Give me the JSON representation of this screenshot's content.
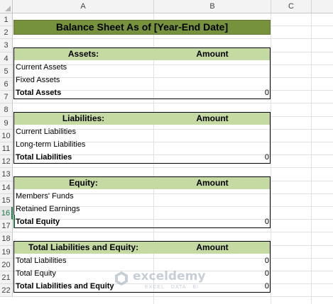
{
  "columns": [
    "A",
    "B",
    "C"
  ],
  "rows": [
    "1",
    "2",
    "3",
    "4",
    "5",
    "6",
    "7",
    "8",
    "9",
    "10",
    "11",
    "12",
    "13",
    "14",
    "15",
    "16",
    "17",
    "18",
    "19",
    "20",
    "21",
    "22"
  ],
  "selected_row": "16",
  "title": "Balance Sheet As of [Year-End Date]",
  "assets": {
    "header": "Assets:",
    "amount_header": "Amount",
    "current": "Current Assets",
    "fixed": "Fixed Assets",
    "total_label": "Total Assets",
    "total_value": "0"
  },
  "liabilities": {
    "header": "Liabilities:",
    "amount_header": "Amount",
    "current": "Current Liabilities",
    "longterm": "Long-term Liabilities",
    "total_label": "Total Liabilities",
    "total_value": "0"
  },
  "equity": {
    "header": "Equity:",
    "amount_header": "Amount",
    "members": "Members' Funds",
    "retained": "Retained Earnings",
    "total_label": "Total Equity",
    "total_value": "0"
  },
  "summary": {
    "header": "Total Liabilities and Equity:",
    "amount_header": "Amount",
    "liab_label": "Total Liabilities",
    "liab_value": "0",
    "equity_label": "Total Equity",
    "equity_value": "0",
    "total_label": "Total Liabilities and Equity",
    "total_value": "0"
  },
  "watermark": {
    "name": "exceldemy",
    "tagline": "EXCEL · DATA · BI"
  },
  "colors": {
    "title_fill": "#76923c",
    "header_fill": "#c5d9a3",
    "excel_green": "#217346"
  }
}
